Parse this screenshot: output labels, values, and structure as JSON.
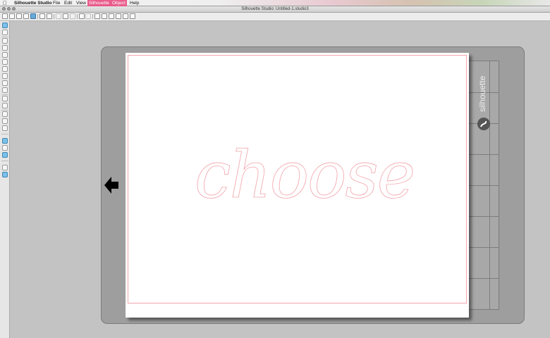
{
  "menubar": {
    "app_name": "Silhouette Studio",
    "items": [
      {
        "label": "File"
      },
      {
        "label": "Edit"
      },
      {
        "label": "View"
      },
      {
        "label": "Silhouette"
      },
      {
        "label": "Object"
      },
      {
        "label": "Help"
      }
    ]
  },
  "window": {
    "title": "Silhouette Studio: Untitled-1.studio3"
  },
  "canvas": {
    "design_text": "choose",
    "mat_brand": "silhouette"
  },
  "colors": {
    "accent": "#6aa9d8",
    "cut_line": "#f2a5ab",
    "mat": "#9e9e9e",
    "menu_highlight": "#e85c8c"
  }
}
